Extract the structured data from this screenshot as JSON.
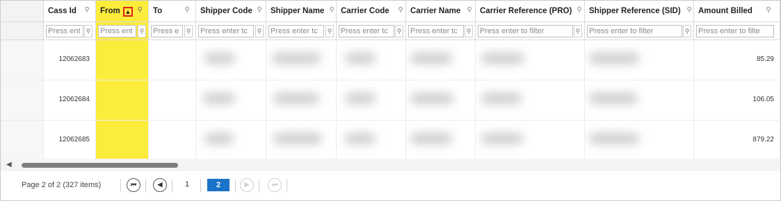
{
  "columns": [
    {
      "key": "cass_id",
      "label": "Cass Id"
    },
    {
      "key": "from",
      "label": "From"
    },
    {
      "key": "to",
      "label": "To"
    },
    {
      "key": "shipper_code",
      "label": "Shipper Code"
    },
    {
      "key": "shipper_name",
      "label": "Shipper Name"
    },
    {
      "key": "carrier_code",
      "label": "Carrier Code"
    },
    {
      "key": "carrier_name",
      "label": "Carrier Name"
    },
    {
      "key": "carrier_ref",
      "label": "Carrier Reference (PRO)"
    },
    {
      "key": "shipper_ref",
      "label": "Shipper Reference (SID)"
    },
    {
      "key": "amount",
      "label": "Amount Billed"
    }
  ],
  "filters": {
    "cass_id": "Press ent",
    "from": "Press ent",
    "to": "Press e",
    "shipper_code": "Press enter tc",
    "shipper_name": "Press enter tc",
    "carrier_code": "Press enter tc",
    "carrier_name": "Press enter tc",
    "carrier_ref": "Press enter to filter",
    "shipper_ref": "Press enter to filter",
    "amount": "Press enter to filte"
  },
  "rows": [
    {
      "cass_id": "12062683",
      "amount": "85.29"
    },
    {
      "cass_id": "12062684",
      "amount": "106.05"
    },
    {
      "cass_id": "12062685",
      "amount": "879.22"
    }
  ],
  "sort_indicator": "▲",
  "sorted_column_color": "#fcec3c",
  "highlight_box_color": "#e02020",
  "pager": {
    "info": "Page 2 of 2 (327 items)",
    "first_icon": "⏮",
    "prev_icon": "◀",
    "next_icon": "▶",
    "last_icon": "⏭",
    "pages": [
      "1",
      "2"
    ],
    "current_page": "2",
    "active_page_color": "#1a73c8"
  },
  "scroll_left_icon": "◀"
}
